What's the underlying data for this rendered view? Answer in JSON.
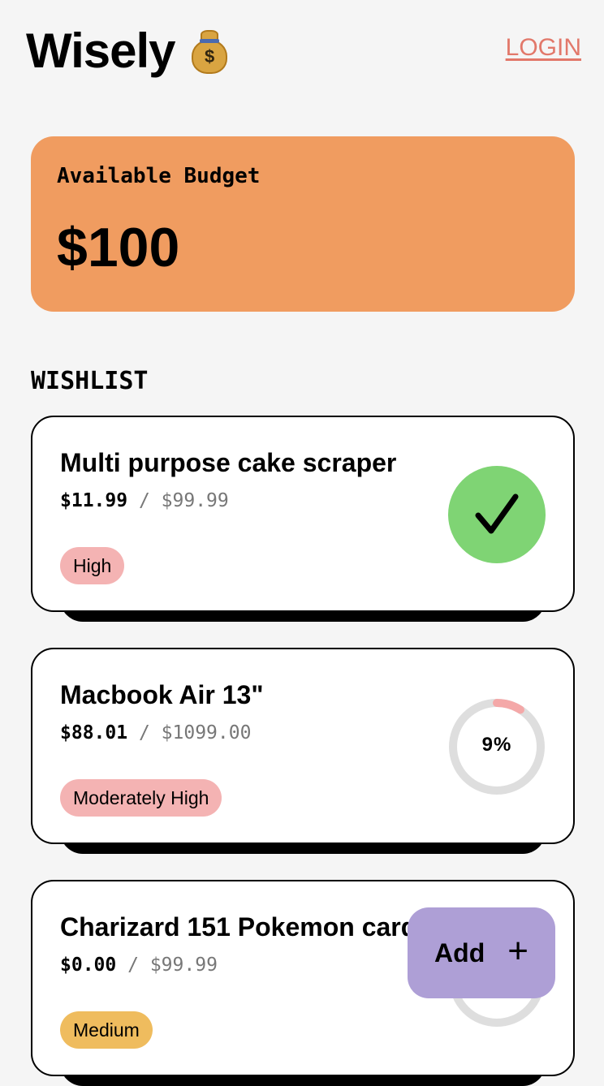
{
  "app": {
    "title": "Wisely",
    "logo_icon": "money-bag-icon",
    "logo_symbol": "$",
    "login_label": "LOGIN"
  },
  "budget": {
    "label": "Available Budget",
    "amount": "$100",
    "color": "#f09c60"
  },
  "wishlist": {
    "title": "WISHLIST",
    "items": [
      {
        "name": "Multi purpose cake scraper",
        "saved": "$11.99",
        "separator": "/",
        "total": "$99.99",
        "priority": "High",
        "priority_color": "#f4b3b3",
        "progress": 1.0,
        "status": "complete",
        "status_icon": "checkmark-icon"
      },
      {
        "name": "Macbook Air 13\"",
        "saved": "$88.01",
        "separator": "/",
        "total": "$1099.00",
        "priority": "Moderately High",
        "priority_color": "#f4b3b3",
        "progress": 0.09,
        "progress_label": "9%"
      },
      {
        "name": "Charizard 151 Pokemon card",
        "saved": "$0.00",
        "separator": "/",
        "total": "$99.99",
        "priority": "Medium",
        "priority_color": "#efbc5e",
        "progress": 0.0
      }
    ]
  },
  "add_button": {
    "label": "Add",
    "icon": "plus-icon",
    "color": "#ae9fd6"
  }
}
